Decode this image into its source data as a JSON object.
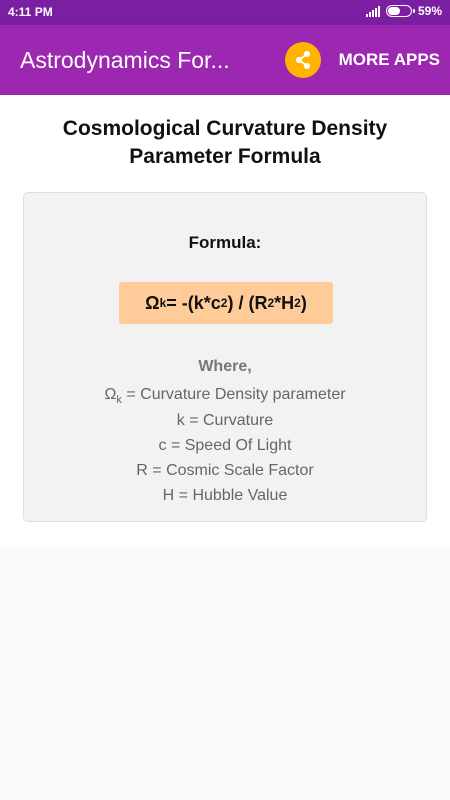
{
  "status_bar": {
    "time": "4:11 PM",
    "battery_pct": "59%",
    "battery_level": 0.59,
    "signal_bars": 5
  },
  "app_bar": {
    "title": "Astrodynamics For...",
    "share_icon": "share-icon",
    "more_apps_label": "MORE APPS",
    "color": "#9c27b0",
    "share_color": "#ffb300"
  },
  "page": {
    "title_line1": "Cosmological Curvature Density",
    "title_line2": "Parameter Formula"
  },
  "formula": {
    "heading": "Formula:",
    "omega": "Ω",
    "omega_sub": "k",
    "part1": " = -(k*c",
    "exp_c": "2",
    "part2": ") / (R",
    "exp_r": "2",
    "part3": "*H",
    "exp_h": "2",
    "part4": ")",
    "highlight_color": "#ffcc99"
  },
  "where": {
    "label": "Where,",
    "definitions": [
      {
        "symbol": "Ω",
        "sub": "k",
        "text": " = Curvature Density parameter"
      },
      {
        "symbol": "k",
        "sub": "",
        "text": " = Curvature"
      },
      {
        "symbol": "c",
        "sub": "",
        "text": " = Speed Of Light"
      },
      {
        "symbol": "R",
        "sub": "",
        "text": " = Cosmic Scale Factor"
      },
      {
        "symbol": "H",
        "sub": "",
        "text": " = Hubble Value"
      }
    ]
  }
}
